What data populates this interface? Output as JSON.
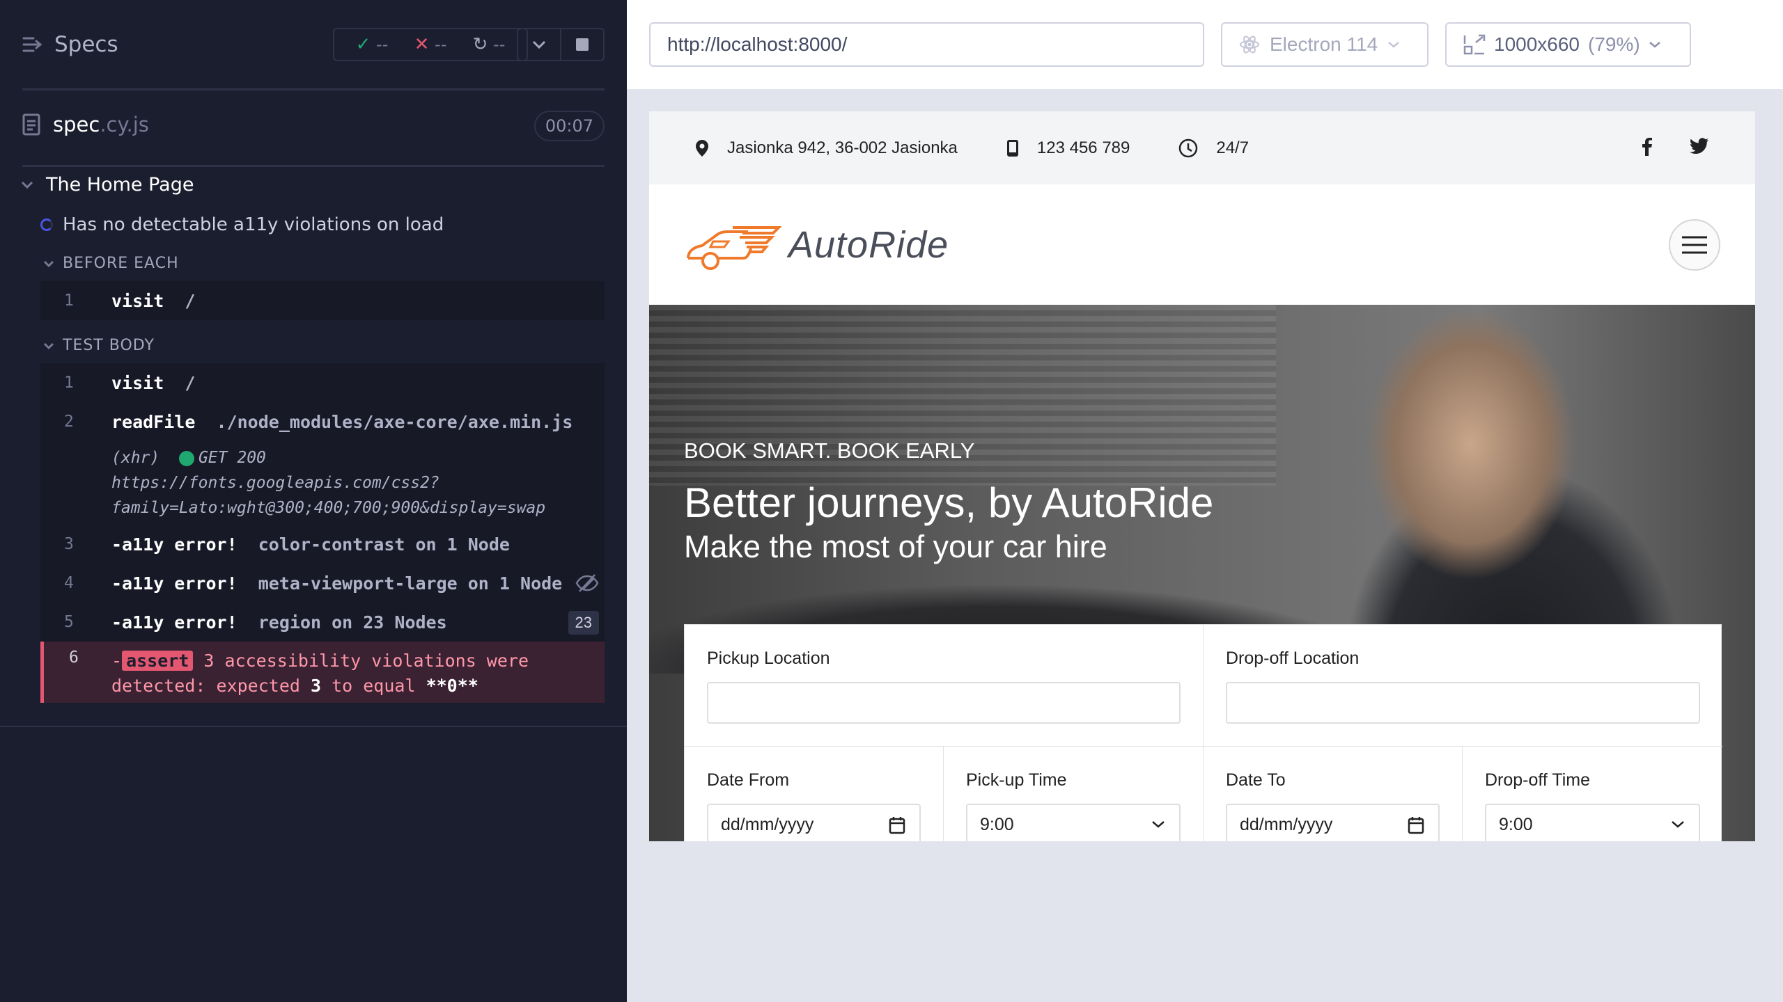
{
  "reporter": {
    "title": "Specs",
    "stats": {
      "passed": "--",
      "failed": "--",
      "pending": "--"
    },
    "spec": {
      "name": "spec",
      "ext": ".cy.js",
      "duration": "00:07"
    },
    "suite": "The Home Page",
    "test": "Has no detectable a11y violations on load",
    "before_each_label": "BEFORE EACH",
    "test_body_label": "TEST BODY",
    "before_each": [
      {
        "num": "1",
        "name": "visit",
        "msg": "/"
      }
    ],
    "body": [
      {
        "num": "1",
        "name": "visit",
        "msg": "/"
      },
      {
        "num": "2",
        "name": "readFile",
        "msg": "./node_modules/axe-core/axe.min.js"
      },
      {
        "num": "3",
        "name": "-a11y error!",
        "msg": "color-contrast on 1 Node"
      },
      {
        "num": "4",
        "name": "-a11y error!",
        "msg": "meta-viewport-large on 1 Node"
      },
      {
        "num": "5",
        "name": "-a11y error!",
        "msg": "region on 23 Nodes",
        "badge": "23"
      }
    ],
    "xhr": {
      "prefix": "(xhr)",
      "status": "GET 200",
      "url_line1": "https://fonts.googleapis.com/css2?",
      "url_line2": "family=Lato:wght@300;400;700;900&display=swap"
    },
    "assert": {
      "num": "6",
      "dash": "-",
      "tag": "assert",
      "text_a": " 3 accessibility violations were",
      "text_b": "detected: expected ",
      "expected": "3",
      "text_c": " to equal ",
      "actual": "**0**"
    }
  },
  "aut": {
    "url": "http://localhost:8000/",
    "browser": "Electron 114",
    "viewport": "1000x660",
    "scale": "(79%)"
  },
  "site": {
    "address": "Jasionka 942, 36-002 Jasionka",
    "phone": "123 456 789",
    "hours": "24/7",
    "logo_text": "AutoRide",
    "hero_kicker": "BOOK SMART. BOOK EARLY",
    "hero_title": "Better journeys, by AutoRide",
    "hero_sub": "Make the most of your car hire",
    "form": {
      "pickup_location": "Pickup Location",
      "dropoff_location": "Drop-off Location",
      "date_from": "Date From",
      "pickup_time": "Pick-up Time",
      "date_to": "Date To",
      "dropoff_time": "Drop-off Time",
      "date_placeholder": "dd/mm/yyyy",
      "time_value": "9:00"
    }
  },
  "colors": {
    "pass": "#1fa971",
    "fail": "#e45770",
    "accent": "#4956e3",
    "brand_orange": "#f07a2b"
  }
}
